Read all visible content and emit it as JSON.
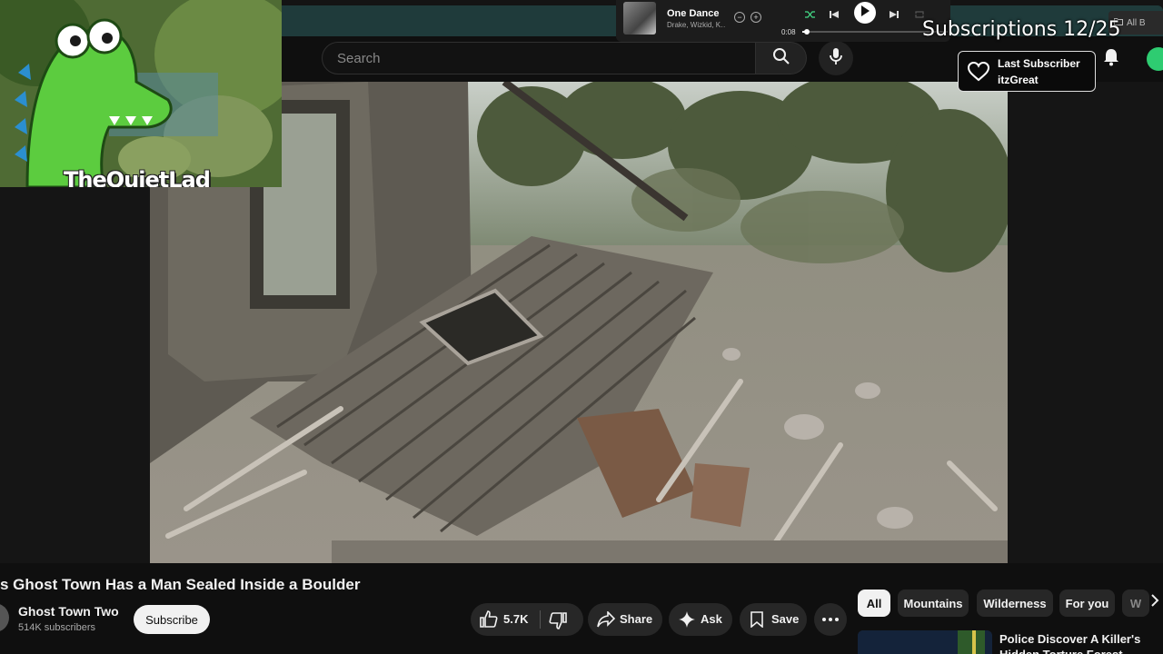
{
  "search": {
    "placeholder": "Search"
  },
  "top_right_tab": "All B",
  "media_player": {
    "title": "One Dance",
    "artist": "Drake, Wizkid, K…",
    "elapsed": "0:08",
    "progress_fraction": 0.03
  },
  "stream_overlay": {
    "subscriptions": "Subscriptions 12/25",
    "last_subscriber_label": "Last Subscriber",
    "last_subscriber_name": "itzGreat",
    "cam_name": "TheQuietLad"
  },
  "video": {
    "title": "s Ghost Town Has a Man Sealed Inside a Boulder",
    "channel": "Ghost Town Two",
    "channel_subs": "514K subscribers",
    "subscribe_label": "Subscribe",
    "likes": "5.7K",
    "share_label": "Share",
    "ask_label": "Ask",
    "save_label": "Save"
  },
  "chips": [
    "All",
    "Mountains",
    "Wilderness",
    "For you",
    "W"
  ],
  "recommendation": {
    "title": "Police Discover A Killer's Hidden Torture Forest"
  },
  "colors": {
    "background": "#0f0f0f",
    "pill": "#272727",
    "accent_avatar": "#2ecc71"
  }
}
